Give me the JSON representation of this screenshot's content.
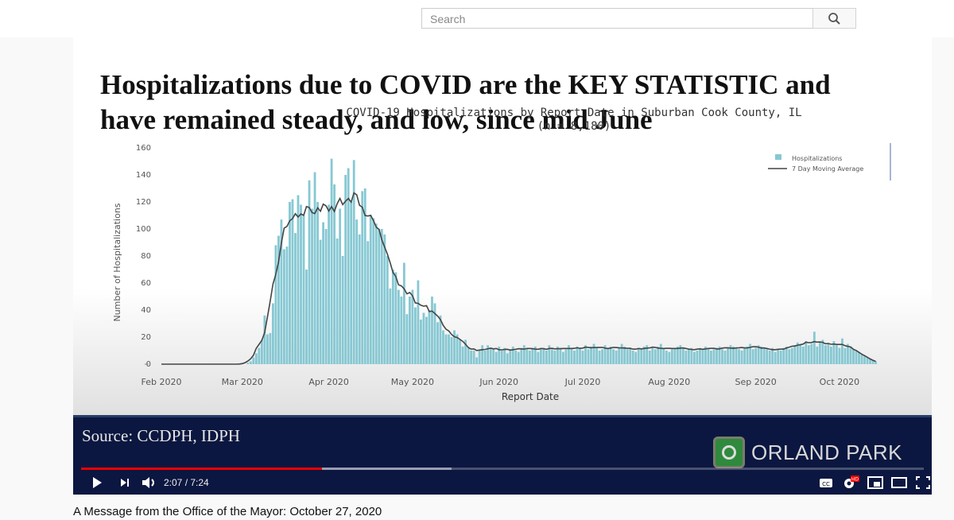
{
  "header": {
    "search_placeholder": "Search",
    "search_icon": "magnifier-icon"
  },
  "slide": {
    "headline_line1": "Hospitalizations due to COVID are the KEY STATISTIC and",
    "headline_line2": "have remained steady, and low, since mid June",
    "source": "Source:  CCDPH, IDPH",
    "logo_text": "ORLAND PARK"
  },
  "player": {
    "current_time": "2:07",
    "duration": "7:24",
    "time_display": "2:07 / 7:24",
    "played_fraction": 0.286,
    "buffered_fraction": 0.44,
    "progress_color": "#ff0000",
    "hd_badge": "HD"
  },
  "video_title": "A Message from the Office of the Mayor: October 27, 2020",
  "chart_data": {
    "type": "bar",
    "title": "COVID-19 Hospitalizations by Report Date in Suburban Cook County, IL",
    "subtitle": "(n = 8,180)",
    "xlabel": "Report Date",
    "ylabel": "Number of Hospitalizations",
    "ylim": [
      0,
      160
    ],
    "yticks": [
      0,
      20,
      40,
      60,
      80,
      100,
      120,
      140,
      160
    ],
    "xticks": [
      "Feb 2020",
      "Mar 2020",
      "Apr 2020",
      "May 2020",
      "Jun 2020",
      "Jul 2020",
      "Aug 2020",
      "Sep 2020",
      "Oct 2020"
    ],
    "xrange": [
      "2020-02-01",
      "2020-10-31"
    ],
    "legend_position": "top-right",
    "grid": false,
    "bar_color": "#86c8d3",
    "line_color": "#444444",
    "series": [
      {
        "name": "Hospitalizations",
        "type": "bar",
        "start_date": "2020-03-03",
        "values": [
          1,
          2,
          5,
          8,
          12,
          18,
          36,
          22,
          23,
          45,
          88,
          95,
          107,
          85,
          87,
          120,
          122,
          97,
          125,
          118,
          110,
          70,
          136,
          115,
          142,
          120,
          92,
          105,
          100,
          118,
          152,
          133,
          93,
          115,
          80,
          140,
          145,
          120,
          151,
          107,
          96,
          128,
          130,
          91,
          110,
          108,
          104,
          100,
          100,
          96,
          80,
          56,
          70,
          68,
          55,
          50,
          75,
          37,
          50,
          55,
          42,
          62,
          33,
          38,
          35,
          40,
          50,
          45,
          31,
          36,
          25,
          22,
          22,
          20,
          25,
          22,
          18,
          13,
          18,
          12,
          10,
          10,
          5,
          10,
          14,
          10,
          14,
          12,
          11,
          9,
          13,
          10,
          12,
          8,
          11,
          13,
          10,
          9,
          12,
          14,
          11,
          10,
          12,
          13,
          9,
          11,
          12,
          10,
          14,
          11,
          10,
          13,
          12,
          9,
          11,
          14,
          12,
          10,
          13,
          12,
          10,
          14,
          11,
          13,
          15,
          12,
          10,
          11,
          14,
          12,
          13,
          11,
          10,
          12,
          15,
          13,
          11,
          12,
          10,
          9,
          12,
          11,
          13,
          14,
          10,
          12,
          11,
          13,
          15,
          12,
          10,
          9,
          11,
          12,
          13,
          14,
          12,
          10,
          11,
          12,
          9,
          10,
          12,
          11,
          13,
          12,
          10,
          11,
          12,
          13,
          11,
          10,
          12,
          14,
          13,
          12,
          11,
          10,
          12,
          13,
          15,
          11,
          12,
          14,
          13,
          12,
          11,
          10,
          12,
          9,
          11,
          10,
          12,
          13,
          11,
          12,
          14,
          16,
          15,
          13,
          17,
          14,
          15,
          24,
          13,
          16,
          18,
          14,
          15,
          13,
          17,
          14,
          12,
          19,
          12,
          15,
          13,
          11,
          10,
          9,
          7,
          6,
          5,
          4,
          3,
          2
        ]
      },
      {
        "name": "7 Day Moving Average",
        "type": "line"
      }
    ]
  }
}
